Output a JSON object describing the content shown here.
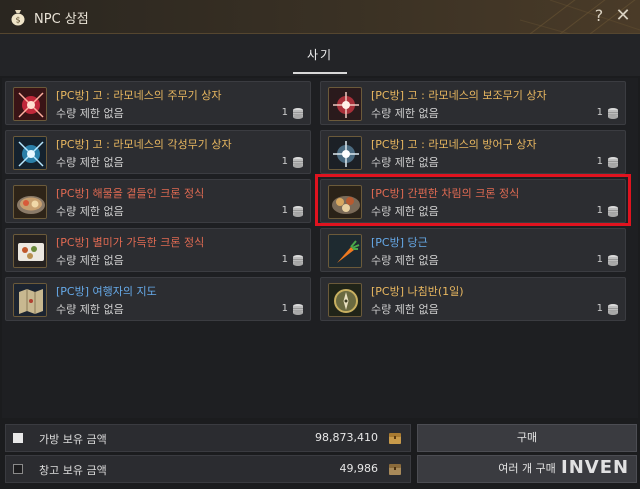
{
  "window": {
    "title": "NPC 상점",
    "help_label": "?",
    "close_label": "✕"
  },
  "tabs": [
    {
      "label": "사기",
      "active": true
    }
  ],
  "items": [
    {
      "name": "[PC방] 고 : 라모네스의 주무기 상자",
      "limit": "수량 제한 없음",
      "qty": "1",
      "name_color": "gold",
      "icon": "red-weapon-box-icon"
    },
    {
      "name": "[PC방] 고 : 라모네스의 보조무기 상자",
      "limit": "수량 제한 없음",
      "qty": "1",
      "name_color": "gold",
      "icon": "red-subweapon-box-icon"
    },
    {
      "name": "[PC방] 고 : 라모네스의 각성무기 상자",
      "limit": "수량 제한 없음",
      "qty": "1",
      "name_color": "gold",
      "icon": "blue-awakening-box-icon"
    },
    {
      "name": "[PC방] 고 : 라모네스의 방어구 상자",
      "limit": "수량 제한 없음",
      "qty": "1",
      "name_color": "gold",
      "icon": "blue-armor-box-icon"
    },
    {
      "name": "[PC방] 해물을 곁들인 크론 정식",
      "limit": "수량 제한 없음",
      "qty": "1",
      "name_color": "red",
      "icon": "seafood-meal-icon"
    },
    {
      "name": "[PC방] 간편한 차림의 크론 정식",
      "limit": "수량 제한 없음",
      "qty": "1",
      "name_color": "red",
      "icon": "simple-meal-icon"
    },
    {
      "name": "[PC방] 별미가 가득한 크론 정식",
      "limit": "수량 제한 없음",
      "qty": "1",
      "name_color": "red",
      "icon": "delicacy-meal-icon"
    },
    {
      "name": "[PC방] 당근",
      "limit": "수량 제한 없음",
      "qty": "1",
      "name_color": "blue",
      "icon": "carrot-icon"
    },
    {
      "name": "[PC방] 여행자의 지도",
      "limit": "수량 제한 없음",
      "qty": "1",
      "name_color": "blue",
      "icon": "map-icon"
    },
    {
      "name": "[PC방] 나침반(1일)",
      "limit": "수량 제한 없음",
      "qty": "1",
      "name_color": "gold",
      "icon": "compass-icon"
    }
  ],
  "funds": {
    "bag": {
      "label": "가방 보유 금액",
      "value": "98,873,410",
      "checked": true
    },
    "storage": {
      "label": "창고 보유 금액",
      "value": "49,986",
      "checked": false
    }
  },
  "buttons": {
    "buy": "구매",
    "buy_multiple": "여러 개 구매"
  },
  "watermark": "INVEN",
  "colors": {
    "gold": "#e8b760",
    "red": "#e06a52",
    "blue": "#66a9e8",
    "highlight": "#e0131f"
  }
}
